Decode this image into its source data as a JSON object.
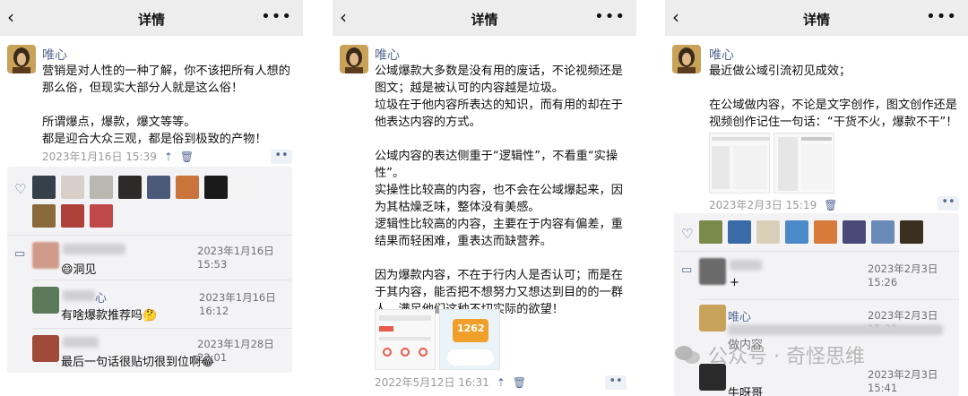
{
  "nav": {
    "back": "‹",
    "title": "详情",
    "more": "•••"
  },
  "author": {
    "name": "唯心"
  },
  "post1": {
    "lines": [
      "营销是对人性的一种了解，你不该把所有人想的",
      "那么俗，但现实大部分人就是这么俗！",
      "",
      "所谓爆点，爆款，爆文等等。",
      "都是迎合大众三观，都是俗到极致的产物！"
    ],
    "time": "2023年1月16日 15:39",
    "comments": [
      {
        "time": "2023年1月16日 15:53",
        "text": "😄洞见"
      },
      {
        "name_suffix": "心",
        "time": "2023年1月16日 16:12",
        "text": "有啥爆款推荐吗🤔"
      },
      {
        "time": "2023年1月28日 22:01",
        "text": "最后一句话很贴切很到位啊😂"
      }
    ]
  },
  "post2": {
    "lines": [
      "公域爆款大多数是没有用的废话，不论视频还是",
      "图文；越是被认可的内容越是垃圾。",
      "垃圾在于他内容所表达的知识，而有用的却在于",
      "他表达内容的方式。",
      "",
      "公域内容的表达侧重于“逻辑性”，不看重“实操",
      "性”。",
      "实操性比较高的内容，也不会在公域爆起来，因",
      "为其枯燥乏味，整体没有美感。",
      "逻辑性比较高的内容，主要在于内容有偏差，重",
      "结果而轻困难，重表达而缺营养。",
      "",
      "因为爆款内容，不在于行内人是否认可；而是在",
      "于其内容，能否把不想努力又想达到目的的一群",
      "人，满足他们这种不切实际的欲望！"
    ],
    "time": "2022年5月12日 16:31",
    "image_number": "1262"
  },
  "post3": {
    "lines": [
      "最近做公域引流初见成效；",
      "",
      "在公域做内容，不论是文字创作，图文创作还是",
      "视频创作记住一句话：“干货不火，爆款不干”！"
    ],
    "time": "2023年2月3日 15:19",
    "comments": [
      {
        "time": "2023年2月3日 15:26",
        "text": "+"
      },
      {
        "name": "唯心",
        "time": "2023年2月3日 15:31",
        "text": "做内容"
      },
      {
        "time": "2023年2月3日 15:41",
        "text": "牛呀哥"
      }
    ]
  },
  "watermark": "公众号 · 奇怪思维",
  "colors": {
    "link": "#576b95",
    "navbar": "#ededed",
    "likes_bg": "#f3f3f5"
  },
  "icons": {
    "pin": "pin-icon",
    "delete": "trash-icon",
    "like": "heart-icon",
    "comment": "comment-icon"
  }
}
